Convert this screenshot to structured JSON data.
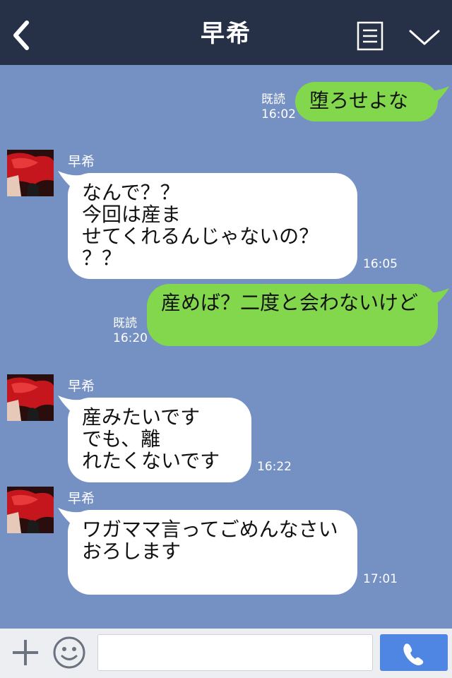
{
  "header": {
    "title": "早希",
    "back_icon": "chevron-left-icon",
    "menu_icon": "list-icon",
    "collapse_icon": "chevron-down-icon"
  },
  "messages": [
    {
      "type": "sent",
      "text": "堕ろせよな",
      "read": "既読",
      "time": "16:02"
    },
    {
      "type": "received",
      "sender": "早希",
      "text": "なんで？？\n今回は産ま\nせてくれるんじゃないの？\n？？",
      "time": "16:05"
    },
    {
      "type": "sent",
      "text": "産めば？二度と会わないけど",
      "read": "既読",
      "time": "16:20"
    },
    {
      "type": "received",
      "sender": "早希",
      "text": "産みたいです\nでも、離\nれたくないです",
      "time": "16:22"
    },
    {
      "type": "received",
      "sender": "早希",
      "text": "ワガママ言ってごめんなさい\nおろします",
      "time": "17:01"
    }
  ],
  "input_bar": {
    "placeholder": "",
    "plus_icon": "plus-icon",
    "emoji_icon": "smiley-icon",
    "call_icon": "phone-icon"
  },
  "colors": {
    "header": "#263047",
    "chat_background": "#7591c3",
    "sent_bubble": "#83d74c",
    "received_bubble": "#ffffff",
    "call_button": "#4f86e3"
  }
}
